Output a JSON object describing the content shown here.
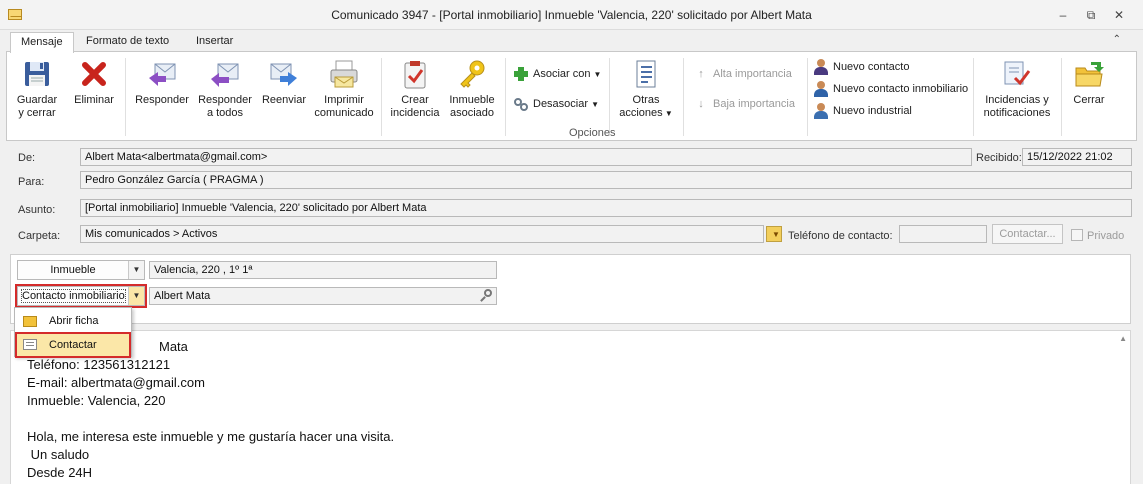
{
  "window": {
    "title": "Comunicado 3947 - [Portal inmobiliario] Inmueble 'Valencia, 220' solicitado por Albert Mata",
    "minimize_glyph": "–",
    "restore_glyph": "⧉",
    "close_glyph": "✕"
  },
  "tabs": [
    {
      "label": "Mensaje",
      "active": true
    },
    {
      "label": "Formato de texto",
      "active": false
    },
    {
      "label": "Insertar",
      "active": false
    }
  ],
  "ribbon": {
    "guardar": "Guardar\ny cerrar",
    "eliminar": "Eliminar",
    "responder": "Responder",
    "responder_todos": "Responder\na todos",
    "reenviar": "Reenviar",
    "imprimir": "Imprimir\ncomunicado",
    "crear_incidencia": "Crear\nincidencia",
    "inmueble_asociado": "Inmueble\nasociado",
    "asociar_con": "Asociar con",
    "desasociar": "Desasociar",
    "otras_acciones": "Otras\nacciones",
    "alta_importancia": "Alta importancia",
    "baja_importancia": "Baja importancia",
    "nuevo_contacto": "Nuevo contacto",
    "nuevo_contacto_inmobiliario": "Nuevo contacto inmobiliario",
    "nuevo_industrial": "Nuevo industrial",
    "incidencias": "Incidencias y\nnotificaciones",
    "cerrar": "Cerrar",
    "group_opciones": "Opciones"
  },
  "form": {
    "de_label": "De:",
    "de_value": "Albert Mata<albertmata@gmail.com>",
    "recibido_label": "Recibido:",
    "recibido_value": "15/12/2022 21:02",
    "para_label": "Para:",
    "para_value": "Pedro González García ( PRAGMA )",
    "asunto_label": "Asunto:",
    "asunto_value": "[Portal inmobiliario] Inmueble 'Valencia, 220' solicitado por Albert Mata",
    "carpeta_label": "Carpeta:",
    "carpeta_value": "Mis comunicados > Activos",
    "telefono_label": "Teléfono de contacto:",
    "telefono_value": "",
    "contactar_button": "Contactar...",
    "privado_label": "Privado"
  },
  "association": {
    "inmueble_combo": "Inmueble",
    "inmueble_value": "Valencia, 220 , 1º 1ª",
    "contacto_combo": "Contacto inmobiliario",
    "contacto_value": "Albert Mata"
  },
  "menu": {
    "items": [
      {
        "label": "Abrir ficha"
      },
      {
        "label": "Contactar"
      }
    ]
  },
  "body": {
    "line1_tail": "Mata",
    "line2": "Teléfono: 123561312121",
    "line3": "E-mail: albertmata@gmail.com",
    "line4": "Inmueble: Valencia, 220",
    "line5": "Hola, me interesa este inmueble y me gustaría hacer una visita.",
    "line6": " Un saludo",
    "line7": "Desde 24H"
  },
  "colors": {
    "highlight": "#d42b2b",
    "menu_selected": "#fbe7a8"
  }
}
